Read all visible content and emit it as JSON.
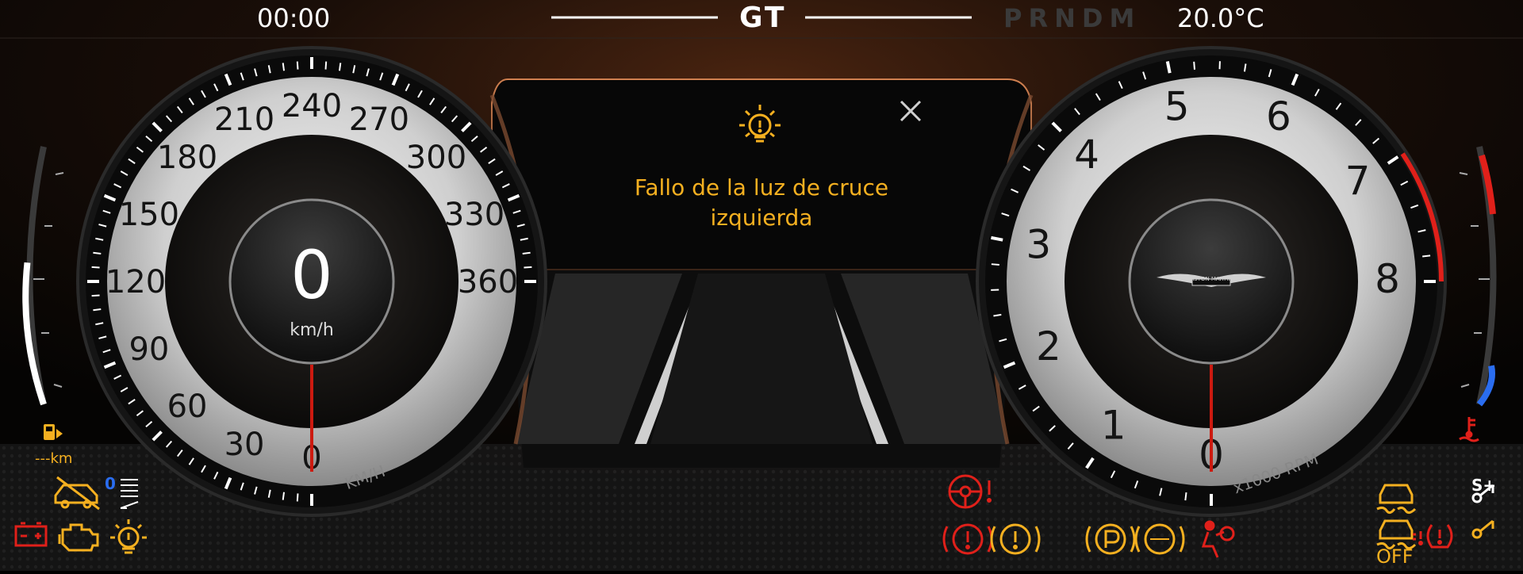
{
  "top_bar": {
    "clock": "00:00",
    "drive_mode": "GT",
    "gear_selector": "PRNDM",
    "temperature": "20.0°C"
  },
  "speedometer": {
    "speed": "0",
    "speed_unit": "km/h",
    "dial_unit": "KM/H",
    "ticks": [
      "0",
      "30",
      "60",
      "90",
      "120",
      "150",
      "180",
      "210",
      "240",
      "270",
      "300",
      "330",
      "360"
    ],
    "needle_value": 0
  },
  "tachometer": {
    "dial_unit": "x1000 RPM",
    "ticks": [
      "0",
      "1",
      "2",
      "3",
      "4",
      "5",
      "6",
      "7",
      "8"
    ],
    "needle_value": 0,
    "brand_badge": "ASTON MARTIN",
    "redline_from": 7
  },
  "alert": {
    "message": "Fallo de la luz de cruce izquierda",
    "icon": "bulb-fault-icon"
  },
  "fuel": {
    "range": "---km",
    "level": 0.55
  },
  "coolant": {
    "level": 0.15
  },
  "indicators": {
    "left": [
      "low-fuel-icon",
      "park-assist-off-icon",
      "gear-indicator-icon",
      "battery-icon",
      "check-engine-icon",
      "exterior-light-fault-icon"
    ],
    "center": [
      "steering-fault-icon",
      "brake-warning-icon",
      "general-warning-icon",
      "parking-brake-icon",
      "abs-icon",
      "airbag-icon"
    ],
    "right": [
      "traction-control-icon",
      "traction-off-icon",
      "tpms-icon",
      "seatbelt-icon",
      "coolant-temp-icon"
    ],
    "gear_indicator_value": "0",
    "traction_off_label": "OFF",
    "sport_plus_label": "S+"
  },
  "colors": {
    "amber": "#f5b020",
    "red": "#e0201a",
    "blue": "#2a6df0",
    "dial_face": "#d8d8d8"
  }
}
